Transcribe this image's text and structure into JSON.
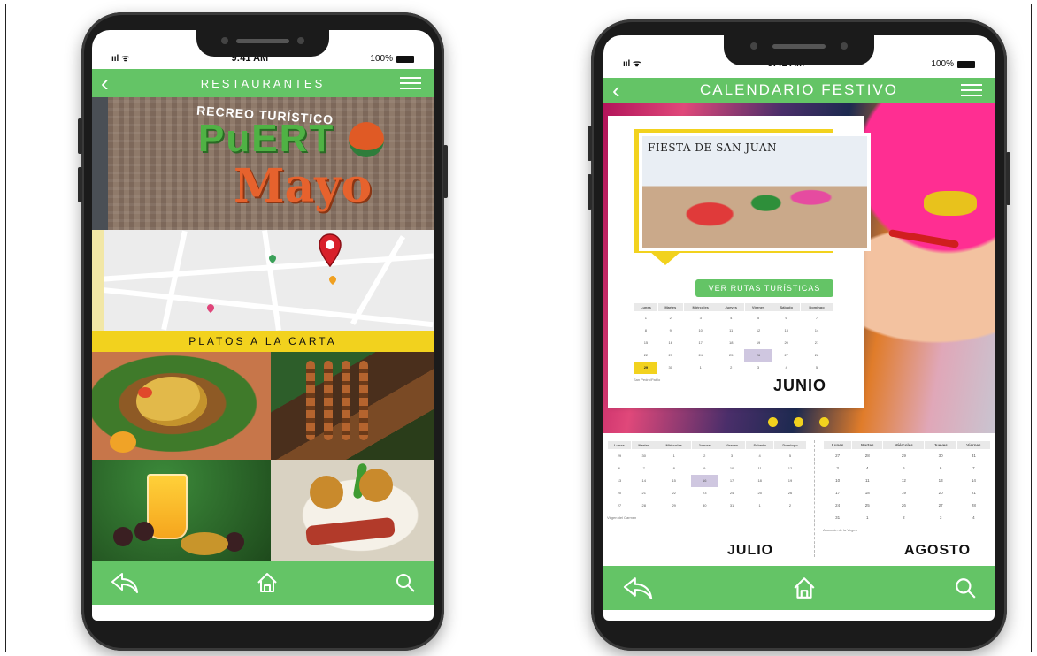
{
  "phone1": {
    "status": {
      "signal": "ııl ᯤ",
      "time": "9:41 AM",
      "battery": "100%"
    },
    "header": {
      "back_glyph": "‹",
      "title": "RESTAURANTES"
    },
    "hero": {
      "line1": "RECREO TURÍSTICO",
      "line2": "PuERT",
      "line3": "Mayo"
    },
    "section_title": "PLATOS A LA CARTA",
    "bottom_nav": [
      "back-arrow-icon",
      "home-icon",
      "search-icon"
    ]
  },
  "phone2": {
    "status": {
      "signal": "ııl ᯤ",
      "time": "9:41 AM",
      "battery": "100%"
    },
    "header": {
      "back_glyph": "‹",
      "title": "CALENDARIO FESTIVO"
    },
    "featured": {
      "title": "FIESTA DE SAN JUAN",
      "button": "VER RUTAS TURÍSTICAS"
    },
    "weekdays": [
      "Lunes",
      "Martes",
      "Miércoles",
      "Jueves",
      "Viernes",
      "Sábado",
      "Domingo"
    ],
    "junio": {
      "label": "JUNIO",
      "rows": [
        [
          "1",
          "2",
          "3",
          "4",
          "5",
          "6",
          "7"
        ],
        [
          "8",
          "9",
          "10",
          "11",
          "12",
          "13",
          "14"
        ],
        [
          "15",
          "16",
          "17",
          "18",
          "19",
          "20",
          "21"
        ],
        [
          "22",
          "23",
          "24",
          "25",
          "26",
          "27",
          "28"
        ],
        [
          "29",
          "30",
          "1",
          "2",
          "3",
          "4",
          "5"
        ]
      ],
      "highlight_yellow": "29",
      "highlight_purple": "26",
      "note": "San Pedro/Pablo"
    },
    "julio": {
      "label": "JULIO",
      "rows": [
        [
          "29",
          "30",
          "1",
          "2",
          "3",
          "4",
          "5"
        ],
        [
          "6",
          "7",
          "8",
          "9",
          "10",
          "11",
          "12"
        ],
        [
          "13",
          "14",
          "15",
          "16",
          "17",
          "18",
          "19"
        ],
        [
          "20",
          "21",
          "22",
          "23",
          "24",
          "25",
          "26"
        ],
        [
          "27",
          "28",
          "29",
          "30",
          "31",
          "1",
          "2"
        ]
      ],
      "highlight_purple": "16",
      "note": "Virgen del Carmen"
    },
    "agosto": {
      "label": "AGOSTO",
      "weekdays": [
        "Lunes",
        "Martes",
        "Miércoles",
        "Jueves",
        "Viernes"
      ],
      "rows": [
        [
          "27",
          "28",
          "29",
          "30",
          "31"
        ],
        [
          "3",
          "4",
          "5",
          "6",
          "7"
        ],
        [
          "10",
          "11",
          "12",
          "13",
          "14"
        ],
        [
          "17",
          "18",
          "19",
          "20",
          "21"
        ],
        [
          "24",
          "25",
          "26",
          "27",
          "28"
        ],
        [
          "31",
          "1",
          "2",
          "3",
          "4"
        ]
      ],
      "note": "Asunción de la Virgen"
    },
    "carousel_dots": 3,
    "bottom_nav": [
      "back-arrow-icon",
      "home-icon",
      "search-icon"
    ]
  },
  "colors": {
    "green": "#64c466",
    "yellow": "#f2d21e",
    "purple": "#cfc7e0"
  }
}
